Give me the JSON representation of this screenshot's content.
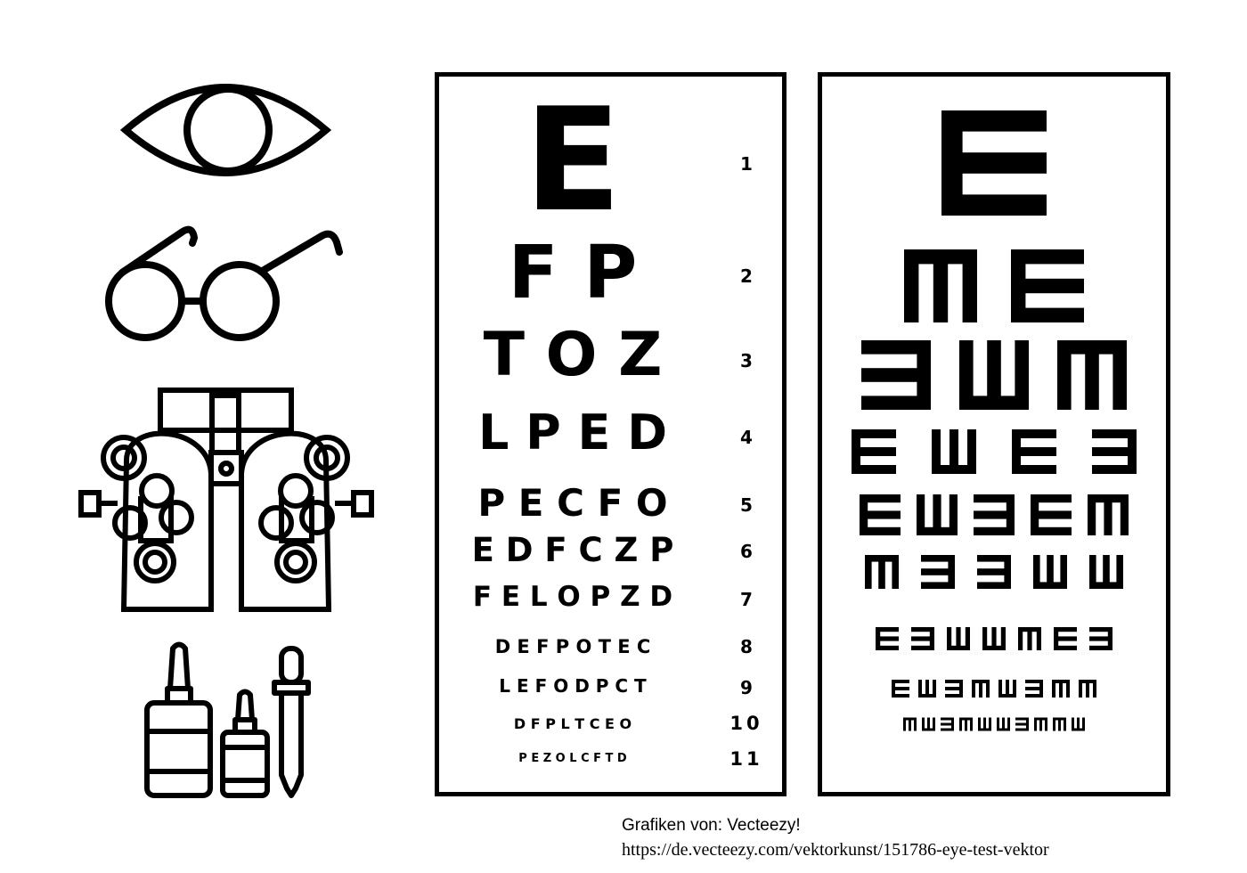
{
  "icons": [
    "eye-icon",
    "glasses-icon",
    "phoropter-icon",
    "eye-drops-icon"
  ],
  "snellen_chart": {
    "rows": [
      {
        "letters": "E",
        "number": "1"
      },
      {
        "letters": "F P",
        "number": "2"
      },
      {
        "letters": "T O Z",
        "number": "3"
      },
      {
        "letters": "L P E D",
        "number": "4"
      },
      {
        "letters": "P E C F O",
        "number": "5"
      },
      {
        "letters": "E D F C Z P",
        "number": "6"
      },
      {
        "letters": "F E L O P Z D",
        "number": "7"
      },
      {
        "letters": "D E F P O T E C",
        "number": "8"
      },
      {
        "letters": "L E F O D P C T",
        "number": "9"
      },
      {
        "letters": "D F P L T C E O",
        "number": "10"
      },
      {
        "letters": "P E Z O L C F T D",
        "number": "11"
      }
    ]
  },
  "tumbling_e_chart": {
    "rows": [
      [
        "right"
      ],
      [
        "down",
        "right"
      ],
      [
        "left",
        "up",
        "down"
      ],
      [
        "right",
        "up",
        "right",
        "left"
      ],
      [
        "right",
        "up",
        "left",
        "right",
        "down"
      ],
      [
        "down",
        "left",
        "left",
        "up",
        "up"
      ],
      [
        "right",
        "left",
        "up",
        "up",
        "down",
        "right",
        "left"
      ],
      [
        "right",
        "up",
        "left",
        "down",
        "up",
        "left",
        "down",
        "down"
      ],
      [
        "down",
        "up",
        "left",
        "down",
        "up",
        "up",
        "left",
        "down",
        "down",
        "up"
      ]
    ]
  },
  "credits": {
    "line1": "Grafiken von: Vecteezy!",
    "line2": "https://de.vecteezy.com/vektorkunst/151786-eye-test-vektor"
  }
}
